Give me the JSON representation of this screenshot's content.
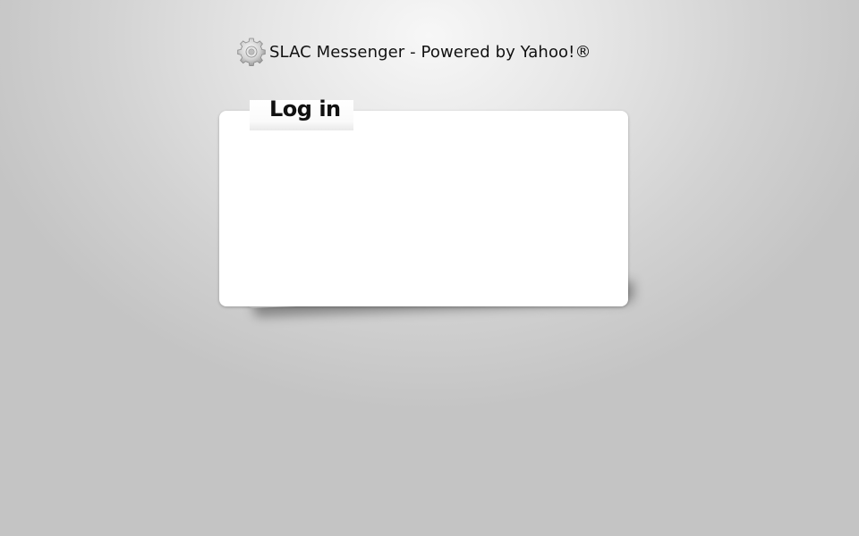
{
  "header": {
    "title": "SLAC Messenger - Powered by Yahoo!®",
    "logo_icon": "gear-icon"
  },
  "login_panel": {
    "tab_label": "Log in"
  },
  "colors": {
    "background": "#c4c4c4",
    "panel": "#ffffff",
    "text": "#111111"
  }
}
